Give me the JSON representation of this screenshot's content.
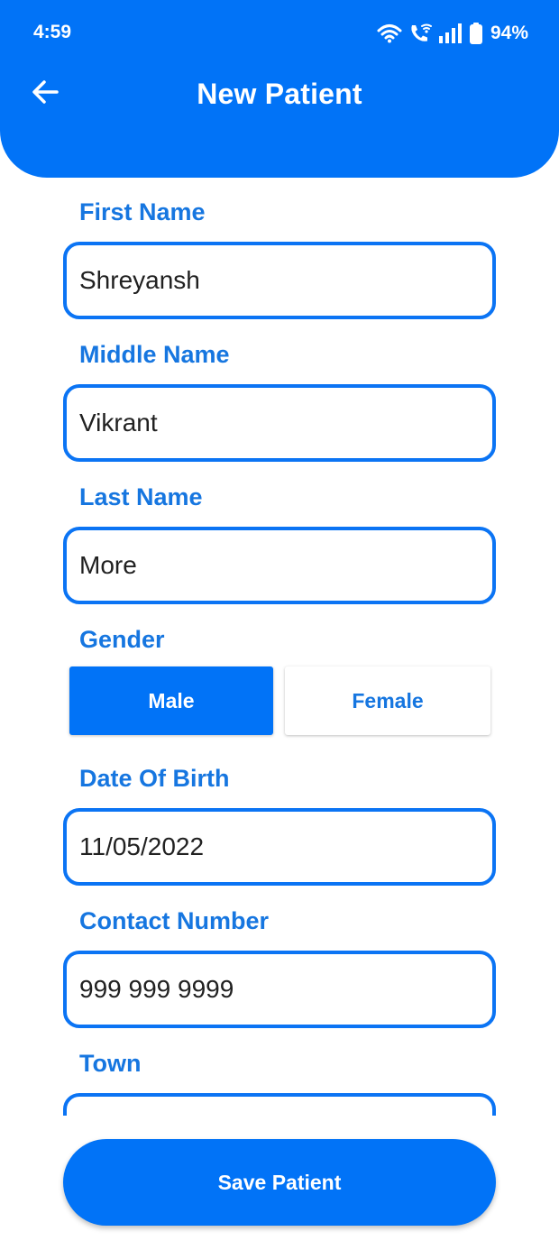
{
  "status_bar": {
    "time": "4:59",
    "battery_percent": "94%",
    "icons": [
      "wifi-icon",
      "wifi-call-icon",
      "signal-icon",
      "battery-icon"
    ]
  },
  "header": {
    "title": "New Patient",
    "back_icon": "arrow-left-icon"
  },
  "form": {
    "first_name": {
      "label": "First Name",
      "value": "Shreyansh"
    },
    "middle_name": {
      "label": "Middle Name",
      "value": "Vikrant"
    },
    "last_name": {
      "label": "Last Name",
      "value": "More"
    },
    "gender": {
      "label": "Gender",
      "options": [
        "Male",
        "Female"
      ],
      "selected": "Male"
    },
    "date_of_birth": {
      "label": "Date Of Birth",
      "value": "11/05/2022"
    },
    "contact_number": {
      "label": "Contact Number",
      "value": "999 999 9999"
    },
    "town": {
      "label": "Town",
      "value": ""
    }
  },
  "actions": {
    "save_label": "Save Patient"
  },
  "colors": {
    "primary": "#0173F7",
    "label": "#1676E0",
    "text": "#212121",
    "background": "#FFFFFF"
  }
}
